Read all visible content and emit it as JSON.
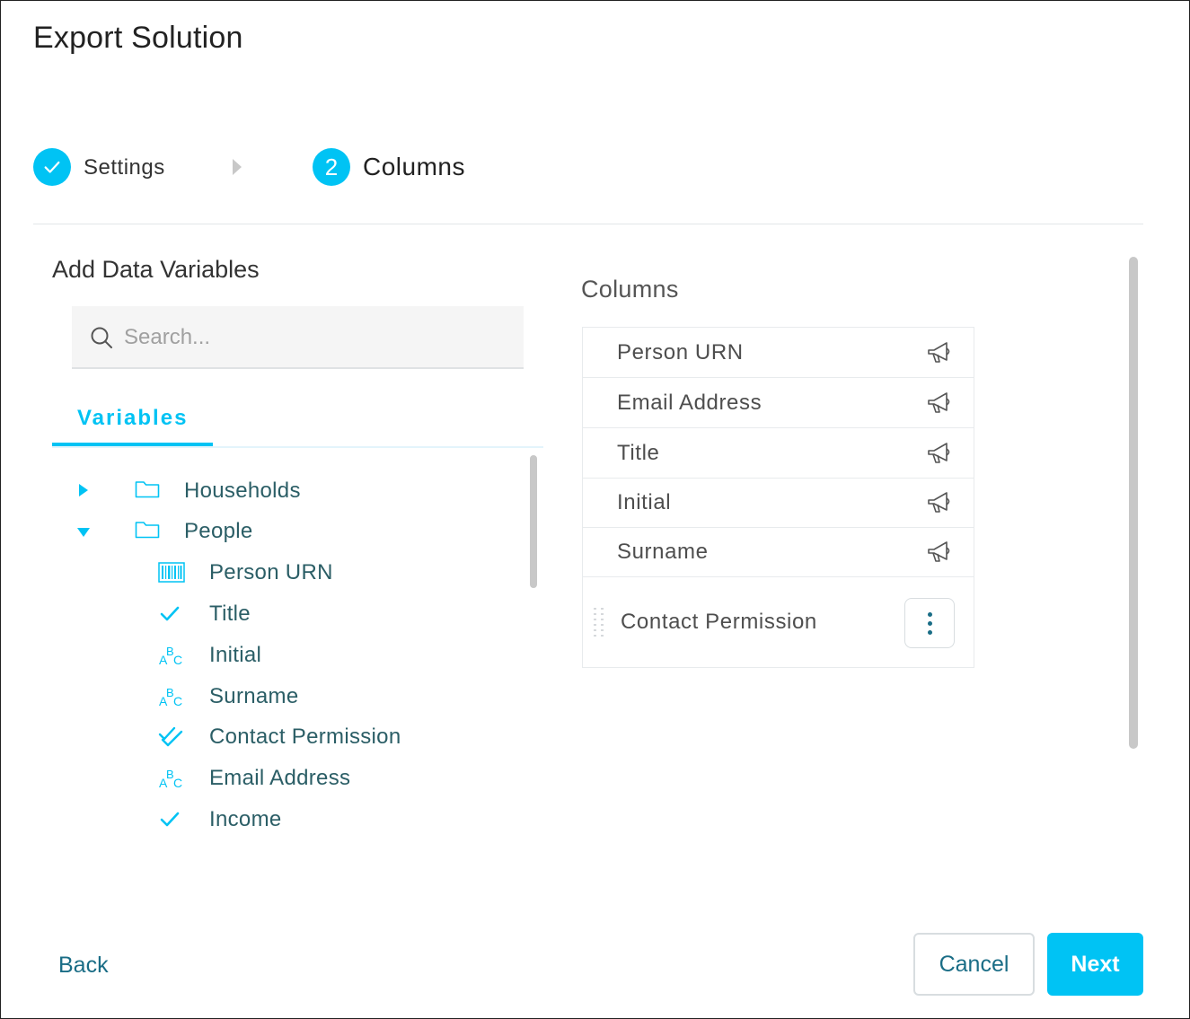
{
  "dialog": {
    "title": "Export Solution"
  },
  "stepper": {
    "steps": [
      {
        "label": "Settings",
        "state": "completed"
      },
      {
        "label": "Columns",
        "number": "2",
        "state": "active"
      }
    ]
  },
  "left_panel": {
    "heading": "Add Data Variables",
    "search": {
      "placeholder": "Search...",
      "value": ""
    },
    "tab": {
      "label": "Variables"
    },
    "tree": {
      "folders": [
        {
          "label": "Households",
          "expanded": false
        },
        {
          "label": "People",
          "expanded": true
        }
      ],
      "people_items": [
        {
          "label": "Person URN",
          "icon": "barcode-icon"
        },
        {
          "label": "Title",
          "icon": "check-icon"
        },
        {
          "label": "Initial",
          "icon": "abc-text-icon"
        },
        {
          "label": "Surname",
          "icon": "abc-text-icon"
        },
        {
          "label": "Contact Permission",
          "icon": "double-check-icon"
        },
        {
          "label": "Email Address",
          "icon": "abc-text-icon"
        },
        {
          "label": "Income",
          "icon": "check-icon"
        }
      ]
    }
  },
  "right_panel": {
    "heading": "Columns",
    "columns": [
      {
        "label": "Person URN",
        "icon": "megaphone-icon"
      },
      {
        "label": "Email Address",
        "icon": "megaphone-icon"
      },
      {
        "label": "Title",
        "icon": "megaphone-icon"
      },
      {
        "label": "Initial",
        "icon": "megaphone-icon"
      },
      {
        "label": "Surname",
        "icon": "megaphone-icon"
      }
    ],
    "selected_column": {
      "label": "Contact Permission",
      "icon": "more-vertical-icon"
    }
  },
  "footer": {
    "back_label": "Back",
    "cancel_label": "Cancel",
    "next_label": "Next"
  },
  "colors": {
    "accent": "#00c3f4",
    "link": "#1a6d86",
    "tree_text": "#2b5e66"
  }
}
